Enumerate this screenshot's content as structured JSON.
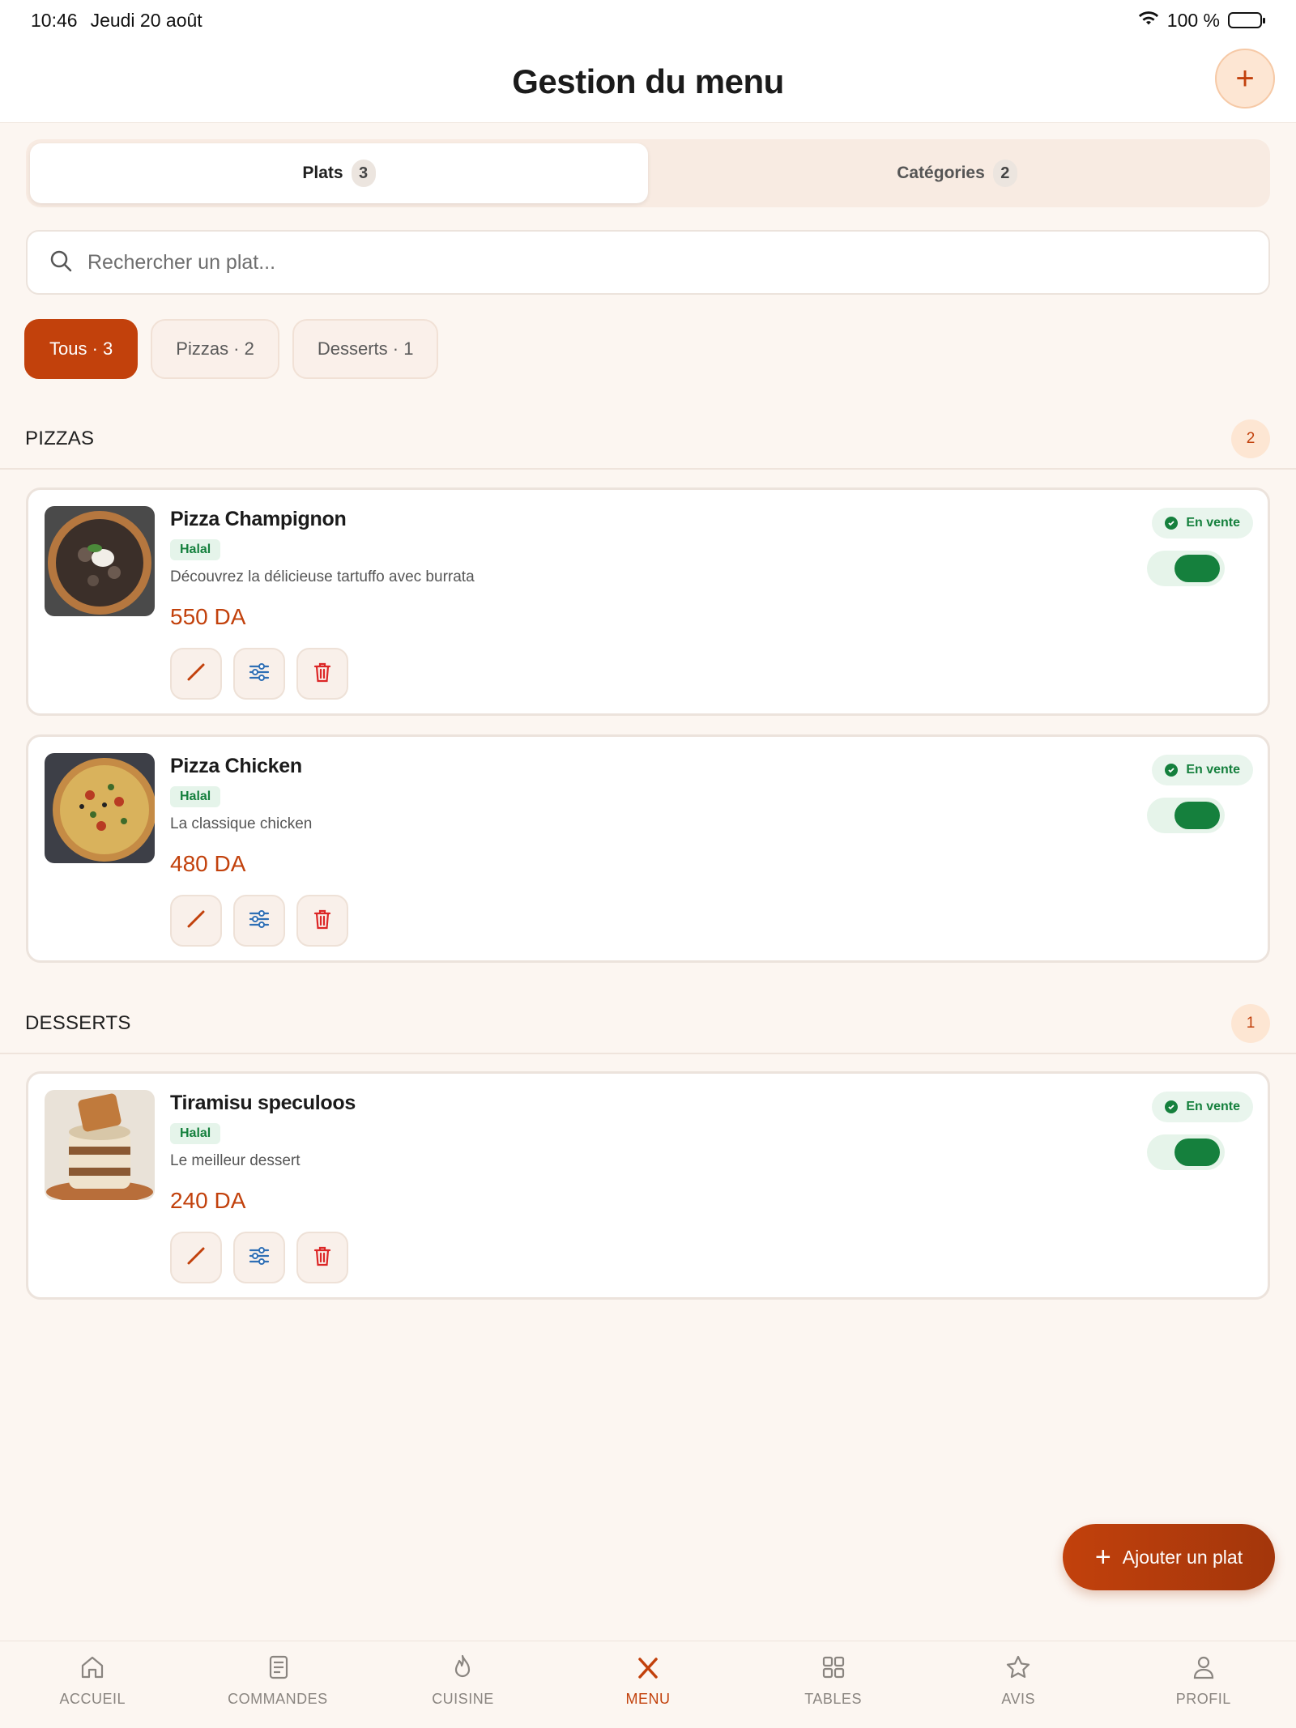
{
  "status_bar": {
    "time": "10:46",
    "date": "Jeudi 20 août",
    "battery": "100 %"
  },
  "header": {
    "title": "Gestion du menu",
    "add_icon": "plus-icon"
  },
  "segments": [
    {
      "label": "Plats",
      "count": "3",
      "active": true
    },
    {
      "label": "Catégories",
      "count": "2",
      "active": false
    }
  ],
  "search": {
    "placeholder": "Rechercher un plat...",
    "value": ""
  },
  "filters": [
    {
      "label": "Tous · 3",
      "active": true
    },
    {
      "label": "Pizzas · 2",
      "active": false
    },
    {
      "label": "Desserts · 1",
      "active": false
    }
  ],
  "sections": [
    {
      "title": "PIZZAS",
      "count": "2",
      "dishes": [
        {
          "name": "Pizza Champignon",
          "tag": "Halal",
          "description": "Découvrez la délicieuse tartuffo avec burrata",
          "price": "550 DA",
          "status": "En vente",
          "on_sale": true
        },
        {
          "name": "Pizza Chicken",
          "tag": "Halal",
          "description": "La classique chicken",
          "price": "480 DA",
          "status": "En vente",
          "on_sale": true
        }
      ]
    },
    {
      "title": "DESSERTS",
      "count": "1",
      "dishes": [
        {
          "name": "Tiramisu speculoos",
          "tag": "Halal",
          "description": "Le meilleur dessert",
          "price": "240 DA",
          "status": "En vente",
          "on_sale": true
        }
      ]
    }
  ],
  "fab": {
    "label": "Ajouter un plat"
  },
  "tabbar": [
    {
      "label": "ACCUEIL",
      "icon": "home-icon",
      "active": false
    },
    {
      "label": "COMMANDES",
      "icon": "receipt-icon",
      "active": false
    },
    {
      "label": "CUISINE",
      "icon": "flame-icon",
      "active": false
    },
    {
      "label": "MENU",
      "icon": "utensils-icon",
      "active": true
    },
    {
      "label": "TABLES",
      "icon": "grid-icon",
      "active": false
    },
    {
      "label": "AVIS",
      "icon": "star-icon",
      "active": false
    },
    {
      "label": "PROFIL",
      "icon": "user-icon",
      "active": false
    }
  ],
  "colors": {
    "accent": "#c2410c",
    "success": "#15803d",
    "background": "#fcf6f1"
  }
}
